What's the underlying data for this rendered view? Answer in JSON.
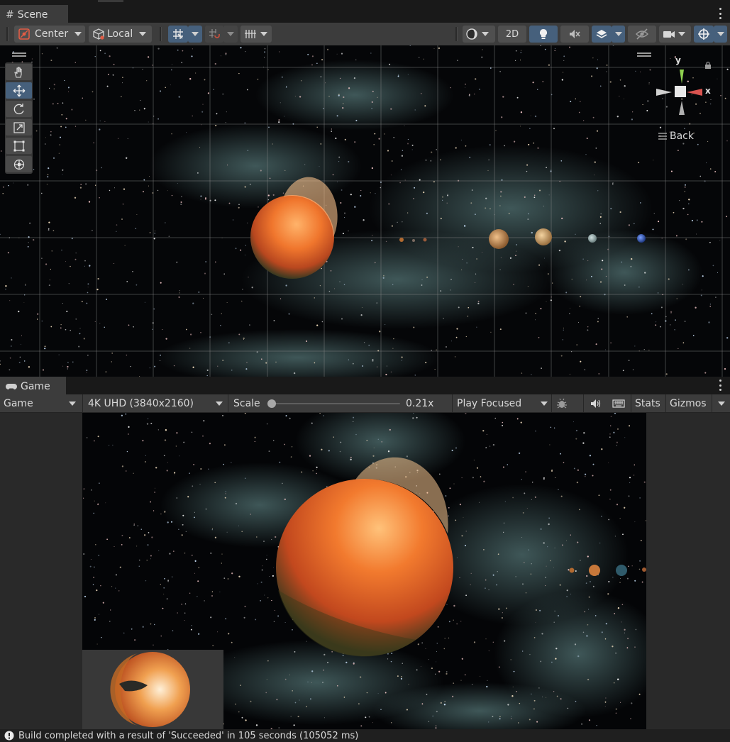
{
  "scene_tab": {
    "label": "Scene"
  },
  "scene_toolbar": {
    "pivot_label": "Center",
    "space_label": "Local",
    "mode_2d_label": "2D"
  },
  "orientation_gizmo": {
    "y_label": "y",
    "x_label": "x",
    "view_label": "Back"
  },
  "game_tab": {
    "label": "Game"
  },
  "game_toolbar": {
    "display_label": "Game",
    "resolution_label": "4K UHD (3840x2160)",
    "scale_label": "Scale",
    "scale_value": "0.21x",
    "scale_fraction": 0.0,
    "play_mode_label": "Play Focused",
    "stats_label": "Stats",
    "gizmos_label": "Gizmos"
  },
  "status": {
    "message": "Build completed with a result of 'Succeeded' in 105 seconds (105052 ms)"
  },
  "colors": {
    "accent_active": "#46607c",
    "panel": "#3c3c3c",
    "sun_orange": "#e8662a",
    "gizmo_y": "#8fd14f",
    "gizmo_x": "#d9534f"
  }
}
